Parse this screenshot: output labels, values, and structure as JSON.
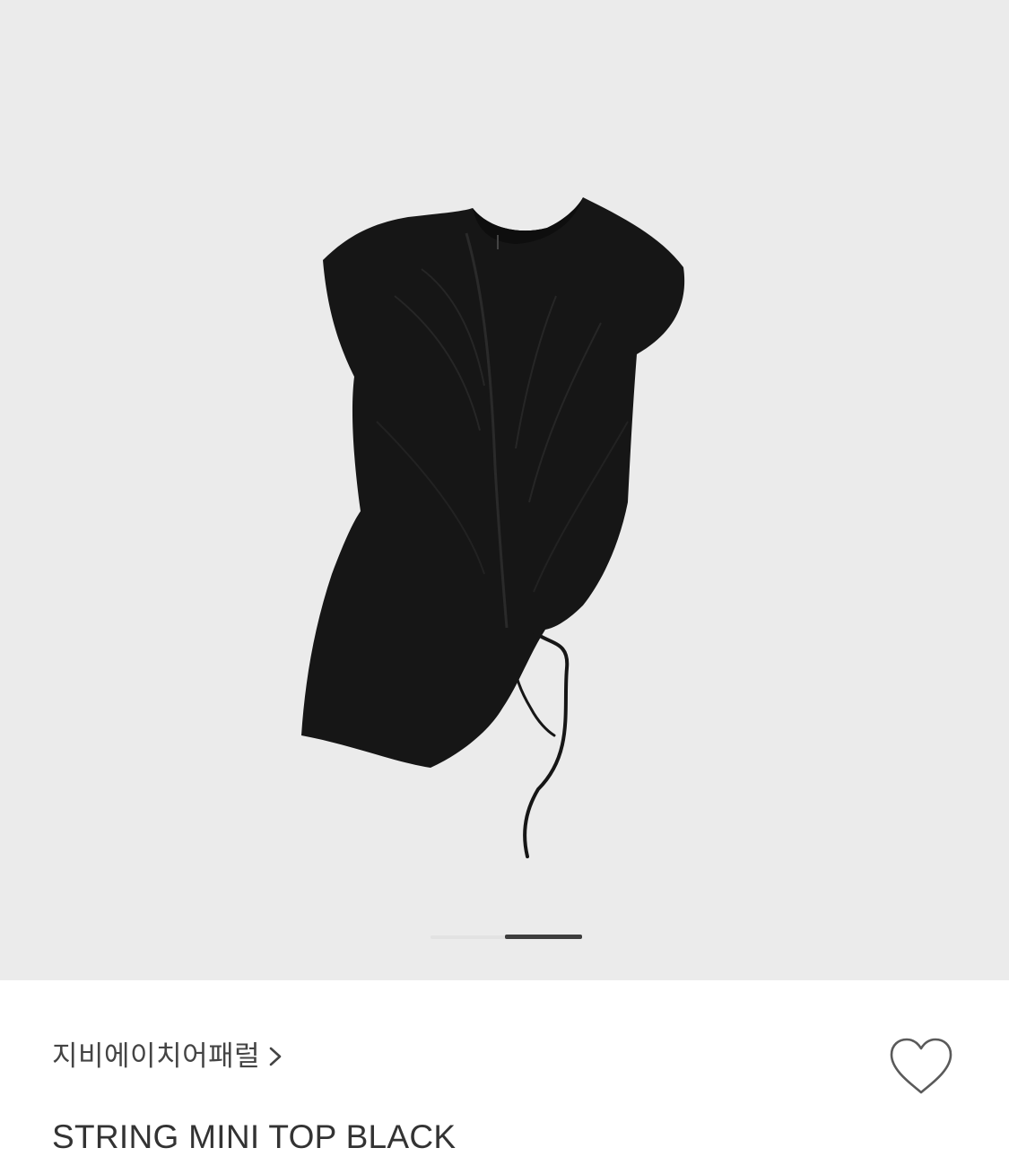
{
  "product": {
    "brand": "지비에이치어패럴",
    "name": "STRING MINI TOP BLACK",
    "garment_color": "#161616",
    "background_color": "#ebebeb"
  },
  "gallery": {
    "current_slide": 2,
    "slide_count": 2
  },
  "icons": {
    "brand_link": "chevron-right-icon",
    "wishlist": "heart-outline-icon"
  }
}
